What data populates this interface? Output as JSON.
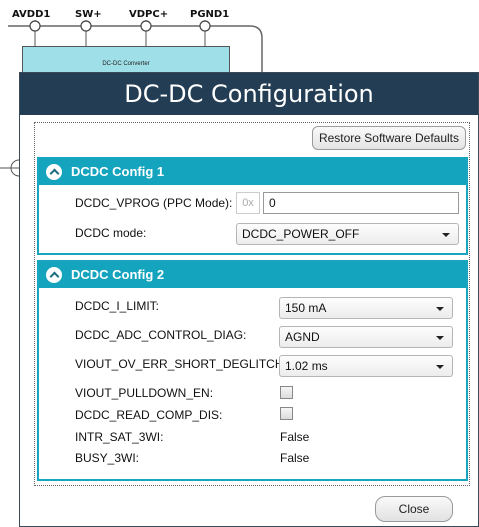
{
  "background": {
    "pins": [
      "AVDD1",
      "SW+",
      "VDPC+",
      "PGND1"
    ],
    "converter_label": "DC-DC Converter"
  },
  "dialog": {
    "title": "DC-DC Configuration",
    "restore_label": "Restore Software Defaults",
    "close_label": "Close",
    "section1": {
      "title": "DCDC Config 1",
      "vprog_label": "DCDC_VPROG (PPC Mode):",
      "vprog_prefix": "0x",
      "vprog_value": "0",
      "mode_label": "DCDC mode:",
      "mode_value": "DCDC_POWER_OFF"
    },
    "section2": {
      "title": "DCDC Config 2",
      "rows": [
        {
          "label": "DCDC_I_LIMIT:",
          "value": "150 mA"
        },
        {
          "label": "DCDC_ADC_CONTROL_DIAG:",
          "value": "AGND"
        },
        {
          "label": "VIOUT_OV_ERR_SHORT_DEGLITCH:",
          "value": "1.02 ms"
        },
        {
          "label": "VIOUT_PULLDOWN_EN:",
          "checked": false
        },
        {
          "label": "DCDC_READ_COMP_DIS:",
          "checked": false
        },
        {
          "label": "INTR_SAT_3WI:",
          "value": "False"
        },
        {
          "label": "BUSY_3WI:",
          "value": "False"
        }
      ]
    }
  },
  "colors": {
    "titlebar": "#233d55",
    "section_accent": "#15a4be",
    "converter_fill": "#9fdfe8"
  }
}
